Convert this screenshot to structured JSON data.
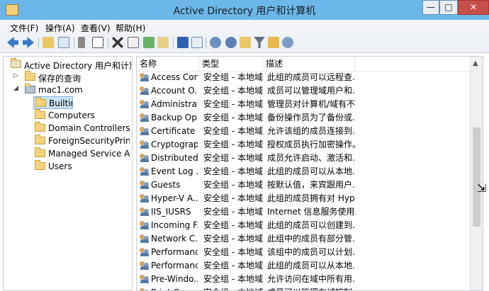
{
  "window": {
    "title": "Active Directory 用户和计算机",
    "minimize": "—",
    "maximize": "□",
    "close": "✕"
  },
  "menu": [
    "文件(F)",
    "操作(A)",
    "查看(V)",
    "帮助(H)"
  ],
  "tree": {
    "root": "Active Directory 用户和计算机",
    "saved": "保存的查询",
    "domain": "mac1.com",
    "children": [
      "Builtin",
      "Computers",
      "Domain Controllers",
      "ForeignSecurityPrincipals",
      "Managed Service Accounts",
      "Users"
    ]
  },
  "list": {
    "columns": [
      "名称",
      "类型",
      "描述"
    ],
    "rows": [
      {
        "name": "Access Con...",
        "type": "安全组 - 本地域",
        "desc": "此组的成员可以远程查..."
      },
      {
        "name": "Account O...",
        "type": "安全组 - 本地域",
        "desc": "成员可以管理域用户和..."
      },
      {
        "name": "Administrat...",
        "type": "安全组 - 本地域",
        "desc": "管理员对计算机/域有不..."
      },
      {
        "name": "Backup Op...",
        "type": "安全组 - 本地域",
        "desc": "备份操作员为了备份或..."
      },
      {
        "name": "Certificate ...",
        "type": "安全组 - 本地域",
        "desc": "允许该组的成员连接到..."
      },
      {
        "name": "Cryptograp...",
        "type": "安全组 - 本地域",
        "desc": "授权成员执行加密操作。"
      },
      {
        "name": "Distributed...",
        "type": "安全组 - 本地域",
        "desc": "成员允许启动、激活和..."
      },
      {
        "name": "Event Log ...",
        "type": "安全组 - 本地域",
        "desc": "此组的成员可以从本地..."
      },
      {
        "name": "Guests",
        "type": "安全组 - 本地域",
        "desc": "按默认值，来宾跟用户..."
      },
      {
        "name": "Hyper-V A...",
        "type": "安全组 - 本地域",
        "desc": "此组的成员拥有对 Hyp..."
      },
      {
        "name": "IIS_IUSRS",
        "type": "安全组 - 本地域",
        "desc": "Internet 信息服务使用..."
      },
      {
        "name": "Incoming F...",
        "type": "安全组 - 本地域",
        "desc": "此组的成员可以创建到..."
      },
      {
        "name": "Network C...",
        "type": "安全组 - 本地域",
        "desc": "此组中的成员有部分管..."
      },
      {
        "name": "Performanc...",
        "type": "安全组 - 本地域",
        "desc": "该组中的成员可以计划..."
      },
      {
        "name": "Performanc...",
        "type": "安全组 - 本地域",
        "desc": "此组的成员可以从本地..."
      },
      {
        "name": "Pre-Windo...",
        "type": "安全组 - 本地域",
        "desc": "允许访问在域中所有用..."
      },
      {
        "name": "Print Opera...",
        "type": "安全组 - 本地域",
        "desc": "成员可以管理在域控制..."
      }
    ]
  }
}
